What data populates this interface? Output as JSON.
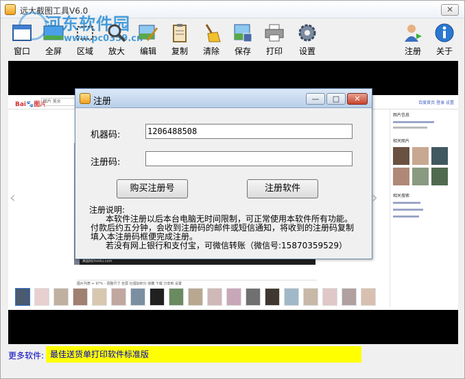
{
  "window": {
    "title": "远大截图工具V6.0",
    "close_label": "✕"
  },
  "watermark": {
    "site_name": "河东软件园",
    "site_url": "www.pc0359.cn"
  },
  "toolbar": {
    "items": [
      {
        "label": "窗口",
        "icon": "window-icon"
      },
      {
        "label": "全屏",
        "icon": "fullscreen-icon"
      },
      {
        "label": "区域",
        "icon": "region-icon"
      },
      {
        "label": "放大",
        "icon": "magnify-icon"
      },
      {
        "label": "编辑",
        "icon": "edit-icon"
      },
      {
        "label": "复制",
        "icon": "copy-icon"
      },
      {
        "label": "清除",
        "icon": "clear-icon"
      },
      {
        "label": "保存",
        "icon": "save-icon"
      },
      {
        "label": "打印",
        "icon": "print-icon"
      },
      {
        "label": "设置",
        "icon": "settings-icon"
      },
      {
        "label": "注册",
        "icon": "register-icon"
      },
      {
        "label": "关于",
        "icon": "about-icon"
      }
    ]
  },
  "preview": {
    "baidu_logo": "Bai🐾图片",
    "search_text": "图片 美女",
    "right_links": "百度首页 登录 设置",
    "side_title_1": "图片信息",
    "side_title_2": "相关图片",
    "side_title_3": "相关搜索",
    "photo_caption": "美图网/meitu.com",
    "tool_row": "图片列表  +  97%  -  调整尺寸  全屏  社福加积分  收藏  下载  分享到  设置"
  },
  "dialog": {
    "title": "注册",
    "minimize": "—",
    "maximize": "□",
    "close": "✕",
    "machine_code_label": "机器码:",
    "machine_code_value": "1206488508",
    "reg_code_label": "注册码:",
    "reg_code_value": "",
    "buy_button": "购买注册号",
    "register_button": "注册软件",
    "desc_title": "注册说明:",
    "desc_line1": "本软件注册以后本台电脑无时间限制，可正常使用本软件所有功能。",
    "desc_line2": "付款后约五分钟，会收到注册码的邮件或短信通知，将收到的注册码复制",
    "desc_line3": "填入本注册码框便完成注册。",
    "desc_line4": "若没有网上银行和支付宝，可微信转账（微信号:15870359529）"
  },
  "footer": {
    "label": "更多软件:",
    "link": "最佳送货单打印软件标准版"
  },
  "colors": {
    "accent": "#2a8fd8",
    "highlight": "#ffff00",
    "link": "#0000c0"
  }
}
